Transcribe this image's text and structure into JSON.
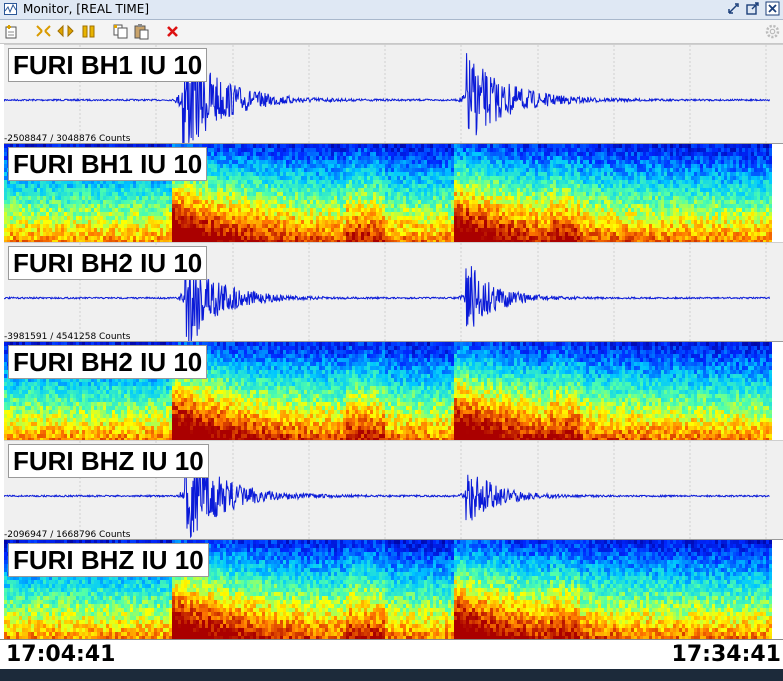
{
  "window": {
    "title": "Monitor, [REAL TIME]"
  },
  "toolbar": {
    "buttons": [
      {
        "name": "new-panel-icon"
      },
      {
        "name": "zoom-out-icon"
      },
      {
        "name": "scroll-icon"
      },
      {
        "name": "pause-icon"
      },
      {
        "name": "copy-icon"
      },
      {
        "name": "paste-icon"
      },
      {
        "name": "close-icon"
      }
    ]
  },
  "channels": [
    {
      "trace_label": "FURI BH1 IU 10",
      "counts": "-2508847 / 3048876 Counts",
      "spec_label": "FURI BH1 IU 10"
    },
    {
      "trace_label": "FURI BH2 IU 10",
      "counts": "-3981591 / 4541258 Counts",
      "spec_label": "FURI BH2 IU 10"
    },
    {
      "trace_label": "FURI BHZ IU 10",
      "counts": "-2096947 / 1668796 Counts",
      "spec_label": "FURI BHZ IU 10"
    }
  ],
  "time": {
    "start": "17:04:41",
    "end": "17:34:41"
  },
  "colors": {
    "trace": "#0a1ad8",
    "titlebar": "#dfe8f4"
  }
}
